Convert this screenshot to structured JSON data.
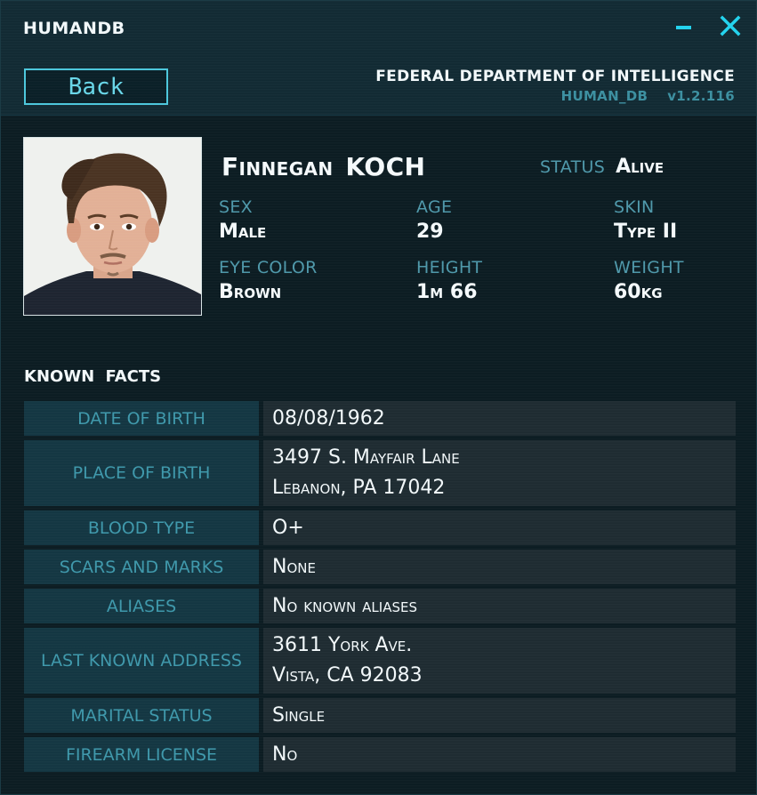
{
  "window": {
    "title": "HUMANDB",
    "minimize_symbol": "—",
    "close_symbol": "X",
    "accent_color": "#22d3ee"
  },
  "header": {
    "back_label": "Back",
    "agency": "FEDERAL DEPARTMENT OF INTELLIGENCE",
    "db_name": "HUMAN_DB",
    "version": "v1.2.116"
  },
  "profile": {
    "first_name": "Finnegan",
    "last_name": "KOCH",
    "status_label": "STATUS",
    "status_value": "Alive",
    "sex_label": "SEX",
    "sex_value": "Male",
    "age_label": "AGE",
    "age_value": "29",
    "skin_label": "SKIN",
    "skin_value": "Type II",
    "eye_label": "EYE COLOR",
    "eye_value": "Brown",
    "height_label": "HEIGHT",
    "height_value": "1m 66",
    "weight_label": "WEIGHT",
    "weight_value": "60kg"
  },
  "facts": {
    "title": "KNOWN FACTS",
    "rows": [
      {
        "label": "DATE OF BIRTH",
        "lines": [
          "08/08/1962"
        ]
      },
      {
        "label": "PLACE OF BIRTH",
        "lines": [
          "3497 S. Mayfair Lane",
          "Lebanon, PA 17042"
        ]
      },
      {
        "label": "BLOOD TYPE",
        "lines": [
          "O+"
        ]
      },
      {
        "label": "SCARS AND MARKS",
        "lines": [
          "None"
        ]
      },
      {
        "label": "ALIASES",
        "lines": [
          "No known aliases"
        ]
      },
      {
        "label": "LAST KNOWN ADDRESS",
        "lines": [
          "3611 York Ave.",
          "Vista, CA 92083"
        ]
      },
      {
        "label": "MARITAL STATUS",
        "lines": [
          "Single"
        ]
      },
      {
        "label": "FIREARM LICENSE",
        "lines": [
          "No"
        ]
      }
    ]
  }
}
